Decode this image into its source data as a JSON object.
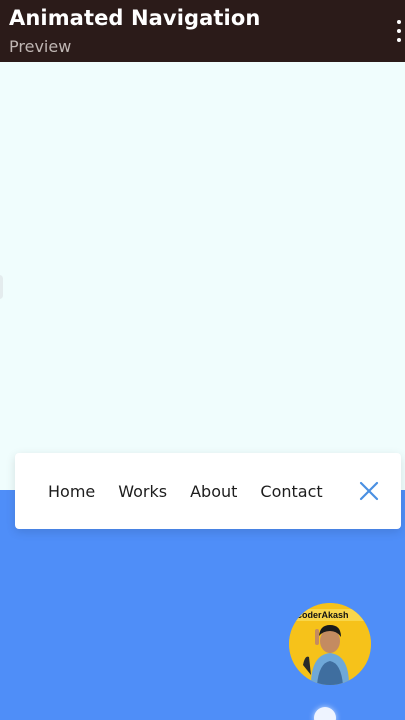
{
  "appbar": {
    "title": "Animated Navigation",
    "subtitle": "Preview",
    "menu_icon": "kebab-menu-icon"
  },
  "nav": {
    "links": [
      {
        "label": "Home"
      },
      {
        "label": "Works"
      },
      {
        "label": "About"
      },
      {
        "label": "Contact"
      }
    ],
    "close_icon": "close-icon"
  },
  "avatar": {
    "label": "coderAkash"
  },
  "colors": {
    "appbar_bg": "#2b1b19",
    "page_bg": "#f0fdfd",
    "blue_area": "#4f8ef8",
    "close_icon": "#4a90e2",
    "avatar_bg": "#f6c21a"
  }
}
